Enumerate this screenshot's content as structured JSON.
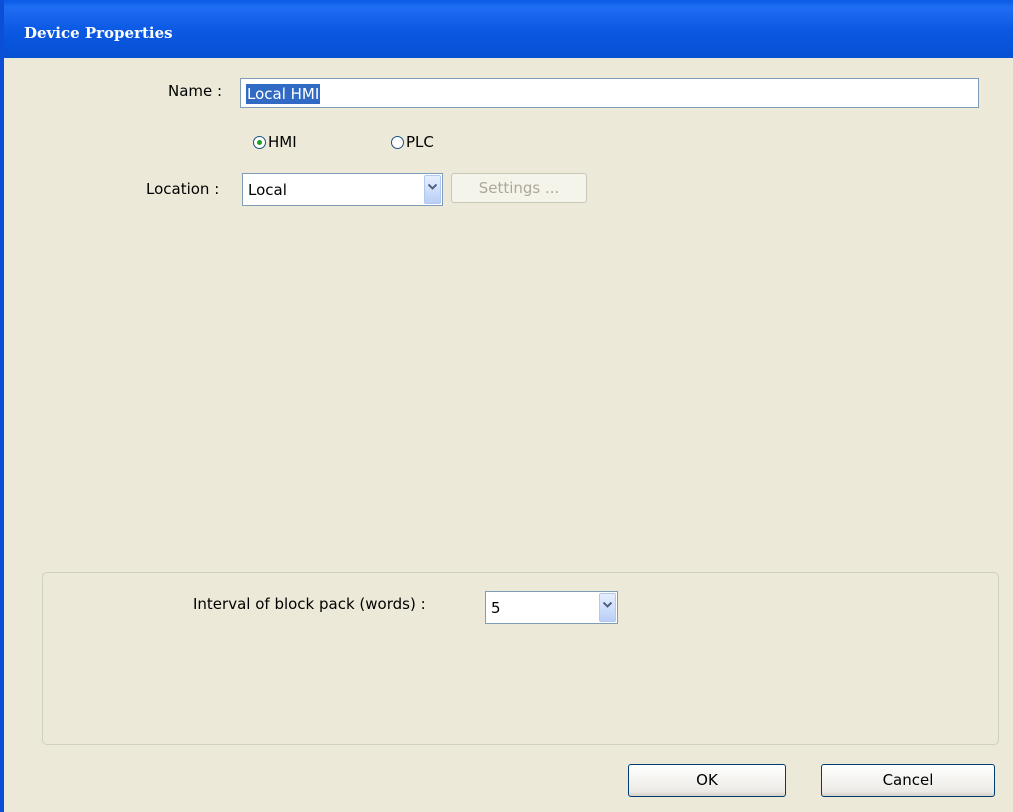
{
  "window": {
    "title": "Device Properties"
  },
  "name_field": {
    "label": "Name :",
    "value": "Local HMI"
  },
  "device_type": {
    "options": [
      "HMI",
      "PLC"
    ],
    "selected": "HMI"
  },
  "location": {
    "label": "Location :",
    "value": "Local",
    "settings_label": "Settings ..."
  },
  "block_pack": {
    "label": "Interval of block pack (words) :",
    "value": "5"
  },
  "buttons": {
    "ok": "OK",
    "cancel": "Cancel"
  },
  "icons": {
    "dropdown": "chevron-down-icon"
  },
  "colors": {
    "titlebar": "#0a58e2",
    "selection": "#316ac5",
    "radio_selected": "#21a121"
  }
}
